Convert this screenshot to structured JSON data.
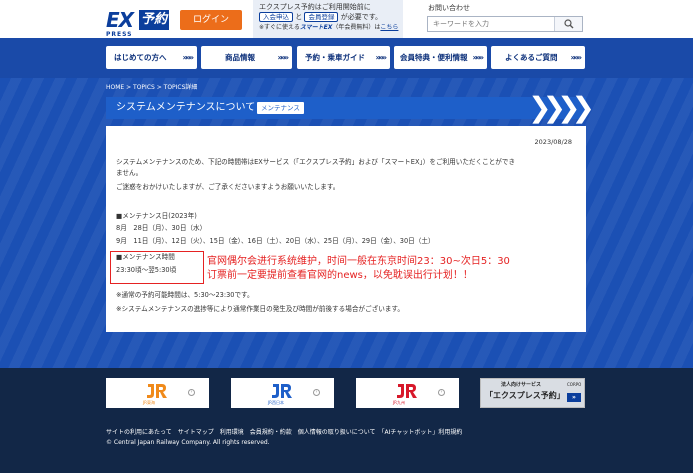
{
  "header": {
    "logo_ex": "EX",
    "logo_yoyaku": "予約",
    "logo_sub": "PRESS",
    "login_label": "ログイン",
    "notice": {
      "line1": "エクスプレス予約はご利用開始前に",
      "btn_admission": "入会申込",
      "conj": "と",
      "btn_member": "会員登録",
      "line2_end": "が必要です。",
      "line3_prefix": "※すぐに使える",
      "smart_ex": "スマートEX",
      "line3_mid": "（年会費無料）は",
      "line3_link": "こちら"
    },
    "inquiry": "お問い合わせ",
    "search_placeholder": "キーワードを入力"
  },
  "nav": {
    "items": [
      {
        "label": "はじめての方へ",
        "chev": "»»»"
      },
      {
        "label": "商品情報",
        "chev": "»»»"
      },
      {
        "label": "予約・乗車ガイド",
        "chev": "»»»"
      },
      {
        "label": "会員特典・便利情報",
        "chev": "»»»"
      },
      {
        "label": "よくあるご質問",
        "chev": "»»»"
      }
    ]
  },
  "breadcrumb": "HOME > TOPICS > TOPICS詳細",
  "page_title": "システムメンテナンスについて",
  "title_badge": "メンテナンス",
  "title_arrows": "❯❯❯❯",
  "article": {
    "date": "2023/08/28",
    "intro_line1": "システムメンテナンスのため、下記の時間帯はEXサービス（「エクスプレス予約」および「スマートEX」）をご利用いただくことができ",
    "intro_line2": "ません。",
    "intro_line3": "ご迷惑をおかけいたしますが、ご了承くださいますようお願いいたします。",
    "days_heading": "■メンテナンス日(2023年)",
    "aug_line": "8月　28日（月）、30日（水）",
    "sep_line": "9月　11日（月）、12日（火）、15日（金）、16日（土）、20日（水）、25日（月）、29日（金）、30日（土）",
    "time_heading": "■メンテナンス時間",
    "time_value": "23:30頃～翌5:30頃",
    "note1": "※通常の予約可能時間は、5:30～23:30です。",
    "note2": "※システムメンテナンスの進捗等により通常作業日の発生及び時間が前後する場合がございます。"
  },
  "annotation": {
    "line1": "官网偶尔会进行系统维护，时间一般在东京时间23：30~次日5：30",
    "line2": "订票前一定要提前查看官网的news，以免耽误出行计划！！"
  },
  "footer": {
    "jr_central": "JR東海",
    "jr_west": "JR西日本",
    "jr_kyushu": "JR九州",
    "biz_small": "法人向けサービス",
    "biz_big": "「エクスプレス予約」",
    "biz_mini": "CORPO",
    "links": "サイトの利用にあたって　サイトマップ　利用環境　会員規約・約款　個人情報の取り扱いについて　「AIチャットボット」利用規約",
    "copyright": "© Central Japan Railway Company. All rights reserved."
  },
  "colors": {
    "brand_blue": "#0b3e9c",
    "nav_blue": "#1a4aa8",
    "login_orange": "#ec6d1a",
    "annotation_red": "#e52222",
    "footer_navy": "#122747",
    "jr_central_orange": "#f08a1a",
    "jr_west_blue": "#1e5fc9",
    "jr_kyushu_red": "#d7182a"
  }
}
